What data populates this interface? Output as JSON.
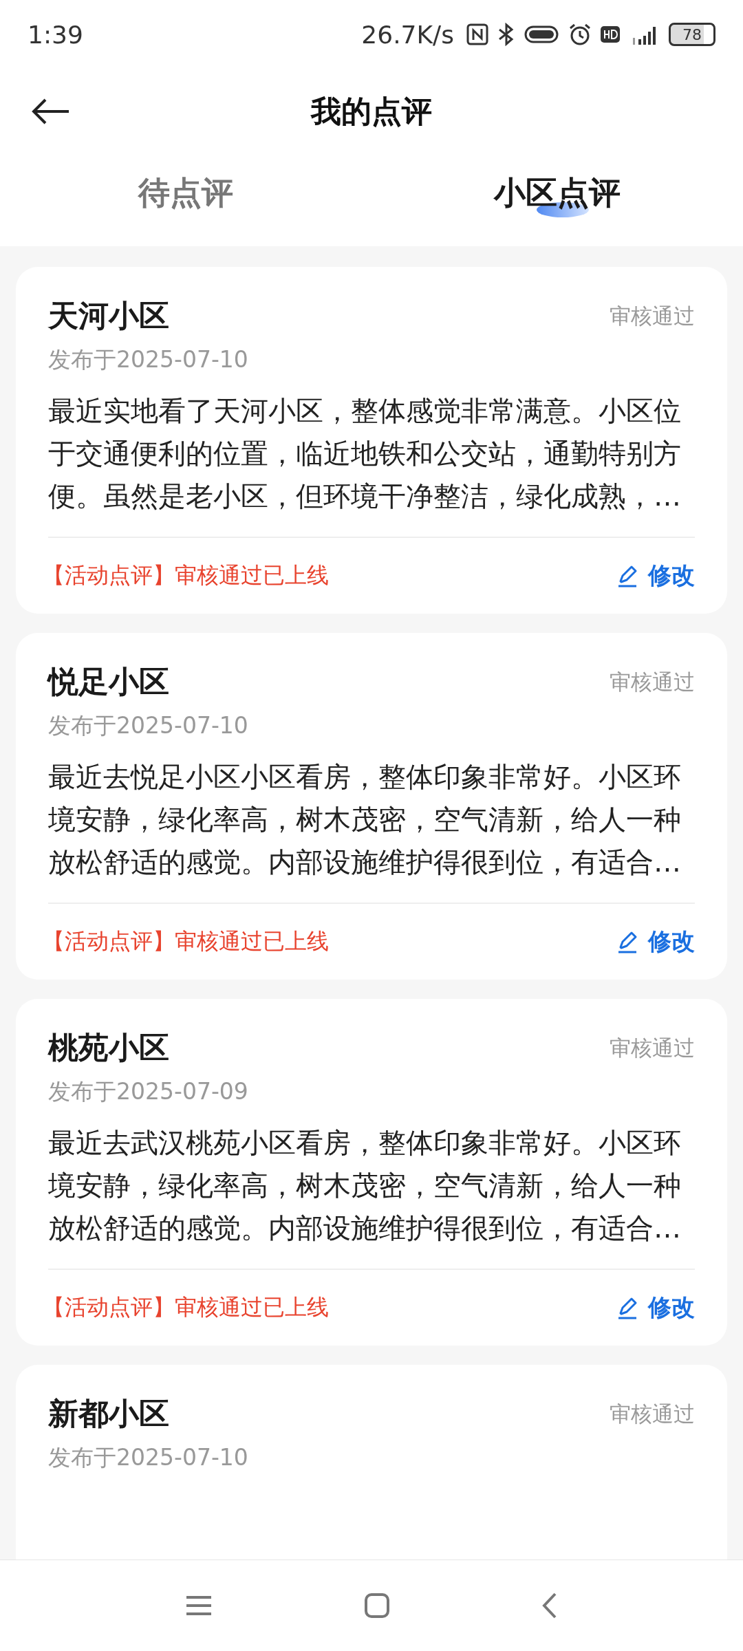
{
  "status_bar": {
    "time": "1:39",
    "speed": "26.7K/s",
    "battery": "78"
  },
  "header": {
    "title": "我的点评"
  },
  "tabs": [
    {
      "label": "待点评",
      "selected": false
    },
    {
      "label": "小区点评",
      "selected": true
    }
  ],
  "reviews": [
    {
      "title": "天河小区",
      "status": "审核通过",
      "date": "发布于2025-07-10",
      "body": "最近实地看了天河小区，整体感觉非常满意。小区位于交通便利的位置，临近地铁和公交站，通勤特别方便。虽然是老小区，但环境干净整洁，绿化成熟，…",
      "note": "【活动点评】审核通过已上线",
      "action": "修改"
    },
    {
      "title": "悦足小区",
      "status": "审核通过",
      "date": "发布于2025-07-10",
      "body": "最近去悦足小区小区看房，整体印象非常好。小区环境安静，绿化率高，树木茂密，空气清新，给人一种放松舒适的感觉。内部设施维护得很到位，有适合…",
      "note": "【活动点评】审核通过已上线",
      "action": "修改"
    },
    {
      "title": "桃苑小区",
      "status": "审核通过",
      "date": "发布于2025-07-09",
      "body": "最近去武汉桃苑小区看房，整体印象非常好。小区环境安静，绿化率高，树木茂密，空气清新，给人一种放松舒适的感觉。内部设施维护得很到位，有适合…",
      "note": "【活动点评】审核通过已上线",
      "action": "修改"
    },
    {
      "title": "新都小区",
      "status": "审核通过",
      "date": "发布于2025-07-10"
    }
  ]
}
